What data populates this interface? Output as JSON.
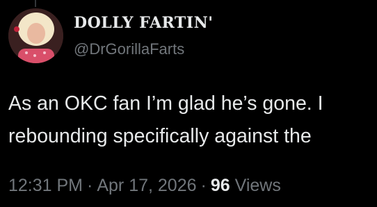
{
  "author": {
    "display_name": "DOLLY FARTIN'",
    "handle": "@DrGorillaFarts",
    "avatar_icon": "profile-photo"
  },
  "tweet": {
    "text_lines": [
      "As an OKC fan I’m glad he’s gone. I",
      "rebounding specifically against the"
    ]
  },
  "meta": {
    "time": "12:31 PM",
    "separator": "·",
    "date": "Apr 17, 2026",
    "views_count": "96",
    "views_label": "Views"
  },
  "colors": {
    "background": "#000000",
    "primary_text": "#e7e9ea",
    "secondary_text": "#71767b"
  }
}
